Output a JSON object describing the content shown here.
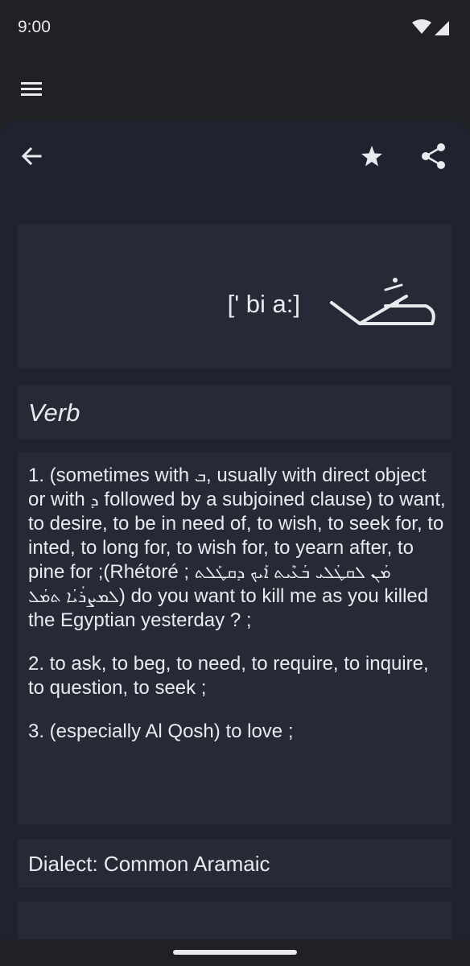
{
  "status_bar": {
    "time": "9:00",
    "icons": [
      "wifi-icon",
      "cell-signal-icon"
    ]
  },
  "app_bar": {
    "menu_icon": "hamburger-menu-icon"
  },
  "toolbar": {
    "back_icon": "arrow-back-icon",
    "favorite_icon": "star-icon",
    "share_icon": "share-icon"
  },
  "entry": {
    "phonetic": "[' bi a:]",
    "syriac_word": "ܒܥܳܐ",
    "part_of_speech": "Verb",
    "definitions": [
      {
        "pre": "1. (sometimes with ",
        "syr_1": "ܒ",
        "mid_1": ", usually with direct object or with ",
        "syr_2": "ܕ",
        "mid_2": " followed by a subjoined clause)  to want, to desire, to be in need of, to wish, to seek for, to inted, to long for, to wish for, to yearn after, to pine for ;(Rhétoré ; ",
        "syr_3": "ܡܳܢ ܠܩܛܳܠܝ ܒܳܥܶܝܬ ܐܰܝܟ ܕܩܛܰܠܬ ܠܡܨܪܳܝܳܐ ܬܡܳܠ",
        "post": ") do you want to kill me as you killed the Egyptian yesterday ? ;"
      },
      {
        "text": "2. to ask, to beg, to need, to require, to inquire, to question, to seek ;"
      },
      {
        "text": "3. (especially Al Qosh) to love ;"
      }
    ],
    "dialect": "Dialect: Common Aramaic"
  },
  "colors": {
    "background": "#202124",
    "sheet": "#1f2330",
    "card": "#252a36",
    "text": "#e8eaed"
  }
}
